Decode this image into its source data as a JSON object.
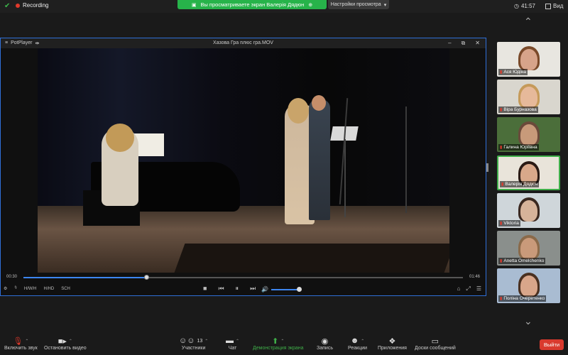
{
  "top": {
    "recording": "Recording",
    "share_banner": "Вы просматриваете экран Валерія Дядюн",
    "view_options": "Настройки просмотра",
    "time": "41:57",
    "view": "Вид"
  },
  "player": {
    "app_name": "PotPlayer",
    "file_title": "Хазова Гра плюс гра.MOV",
    "time_current": "00:30",
    "time_total": "01:46",
    "progress_fraction": 0.28,
    "volume_fraction": 1.0,
    "labels": [
      "H/W/H",
      "H/HD",
      "SCH"
    ]
  },
  "participants": [
    {
      "name": "Ася Юдіна",
      "skin": "#d7a48a",
      "hair": "#7a4a2a",
      "bg": "#e8e6e0",
      "active": false
    },
    {
      "name": "Віра Бурназова",
      "skin": "#e6b99a",
      "hair": "#c59a5a",
      "bg": "#d9d6ce",
      "active": false
    },
    {
      "name": "Галина Юріївна",
      "skin": "#c89a7a",
      "hair": "#6a4a3a",
      "bg": "#4b6e3a",
      "active": false
    },
    {
      "name": "Валерія Дядюн",
      "skin": "#d9a88a",
      "hair": "#2a1a14",
      "bg": "#e9e4da",
      "active": true
    },
    {
      "name": "Viktoria",
      "skin": "#d6b39a",
      "hair": "#3a2820",
      "bg": "#cfd6da",
      "active": false
    },
    {
      "name": "Anetta Omelchenko",
      "skin": "#c99a7a",
      "hair": "#8a6a4a",
      "bg": "#8a8f8c",
      "active": false
    },
    {
      "name": "Поліна Очеретенко",
      "skin": "#d9a68a",
      "hair": "#4a3020",
      "bg": "#a9bcd2",
      "active": false
    }
  ],
  "toolbar": {
    "audio": "Включить звук",
    "video": "Остановить видео",
    "participants": "Участники",
    "participants_count": "13",
    "chat": "Чат",
    "share": "Демонстрация экрана",
    "record": "Запись",
    "reactions": "Реакции",
    "apps": "Приложения",
    "whiteboards": "Доски сообщений",
    "end": "Выйти"
  },
  "colors": {
    "accent_green": "#3fae49",
    "end_red": "#d93a2e",
    "player_blue": "#2f6fd8"
  }
}
